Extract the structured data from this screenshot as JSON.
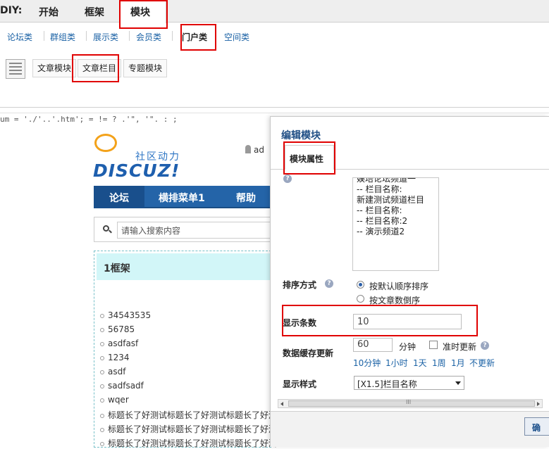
{
  "topbar": {
    "prefix": "DIY:",
    "tabs": [
      "开始",
      "框架",
      "模块"
    ]
  },
  "subnav": [
    "论坛类",
    "群组类",
    "展示类",
    "会员类",
    "门户类",
    "空间类"
  ],
  "modules": [
    "文章模块",
    "文章栏目",
    "专题模块"
  ],
  "code_line": "um = './'..'.htm'; = != ? .'\", '\". : ;",
  "preview": {
    "logo_cn": "社区动力",
    "logo_en": "DISCUZ!",
    "user": "ad",
    "nav": [
      "论坛",
      "横排菜单1",
      "帮助"
    ],
    "search_placeholder": "请输入搜索内容",
    "frame_title": "1框架",
    "list": [
      "34543535",
      "56785",
      "asdfasf",
      "1234",
      "asdf",
      "sadfsadf",
      "wqer",
      "标题长了好测试标题长了好测试标题长了好测",
      "标题长了好测试标题长了好测试标题长了好测",
      "标题长了好测试标题长了好测试标题长了好测"
    ]
  },
  "dialog": {
    "title": "编辑模块",
    "tab": "模块属性",
    "listbox": [
      "娱培论坛频道一",
      "-- 栏目名称:",
      "新建测试频道栏目",
      "-- 栏目名称:",
      "-- 栏目名称:2",
      "-- 演示频道2"
    ],
    "sort_label": "排序方式",
    "sort_options": [
      "按默认顺序排序",
      "按文章数倒序"
    ],
    "count_label": "显示条数",
    "count_value": "10",
    "cache_label": "数据缓存更新",
    "cache_value": "60",
    "cache_unit": "分钟",
    "cache_check": "准时更新",
    "cache_links": [
      "10分钟",
      "1小时",
      "1天",
      "1周",
      "1月",
      "不更新"
    ],
    "style_label": "显示样式",
    "style_value": "[X1.5]栏目名称",
    "scroll_grip": "III",
    "confirm": "确"
  }
}
